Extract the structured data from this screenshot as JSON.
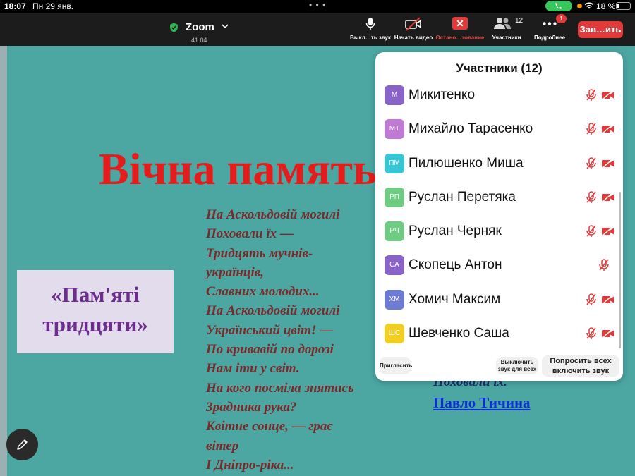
{
  "status_bar": {
    "time": "18:07",
    "date": "Пн 29 янв.",
    "battery_text": "18 %",
    "battery_level": 0.18,
    "icons": [
      "phone-icon",
      "wifi-icon",
      "battery-icon"
    ]
  },
  "toolbar": {
    "meeting_title": "Zoom",
    "timer": "41:04",
    "mute_label": "Выкл…ть звук",
    "video_label": "Начать видео",
    "share_label": "Остано…зование",
    "participants_label": "Участники",
    "participants_count": "12",
    "more_label": "Подробнее",
    "more_badge": "1",
    "end_label": "Зав…ить",
    "colors": {
      "end": "#e03a3a",
      "bar": "#1c1c1c",
      "shield": "#2fb84f"
    }
  },
  "slide": {
    "title": "Вічна память",
    "box_text_line1": "«Пам'яті",
    "box_text_line2": "тридцяти»",
    "poem": [
      "На Аскольдовій могилі",
      "Поховали їх —",
      "Тридцять мучнів-",
      "українців,",
      "Славних молодих...",
      "На Аскольдовій могилі",
      "Український цвіт! —",
      "По кривавій по дорозі",
      "Нам іти у світ.",
      "На кого посміла знятись",
      "Зрадника рука?",
      "Квітне сонце, — грає",
      "вітер",
      "І Дніпро-ріка..."
    ],
    "poem_tail": "Поховали їх.",
    "author": "Павло Тичина",
    "colors": {
      "background": "#4ca7a3",
      "title": "#e51c1c",
      "poem": "#7a2a2a",
      "box_text": "#6b2e8a",
      "link": "#0b2fd8"
    }
  },
  "panel": {
    "title": "Участники (12)",
    "participants": [
      {
        "initials": "М",
        "name": "Микитенко",
        "color": "#8a63c9",
        "camera_off": true
      },
      {
        "initials": "МТ",
        "name": "Михайло Тарасенко",
        "color": "#c07ad6",
        "camera_off": true
      },
      {
        "initials": "ПМ",
        "name": "Пилюшенко Миша",
        "color": "#37c6d6",
        "camera_off": true
      },
      {
        "initials": "РП",
        "name": "Руслан Перетяка",
        "color": "#6fca82",
        "camera_off": true
      },
      {
        "initials": "РЧ",
        "name": "Руслан Черняк",
        "color": "#6fca82",
        "camera_off": true
      },
      {
        "initials": "СА",
        "name": "Скопець Антон",
        "color": "#8a63c9",
        "camera_off": false
      },
      {
        "initials": "ХМ",
        "name": "Хомич Максим",
        "color": "#6d7bd4",
        "camera_off": true
      },
      {
        "initials": "ШС",
        "name": "Шевченко Саша",
        "color": "#f2cf1e",
        "camera_off": true
      }
    ],
    "invite_label": "Пригласить",
    "mute_all_line1": "Выключить",
    "mute_all_line2": "звук для всех",
    "ask_unmute_line1": "Попросить всех",
    "ask_unmute_line2": "включить звук",
    "muted_color": "#e03a3a"
  }
}
